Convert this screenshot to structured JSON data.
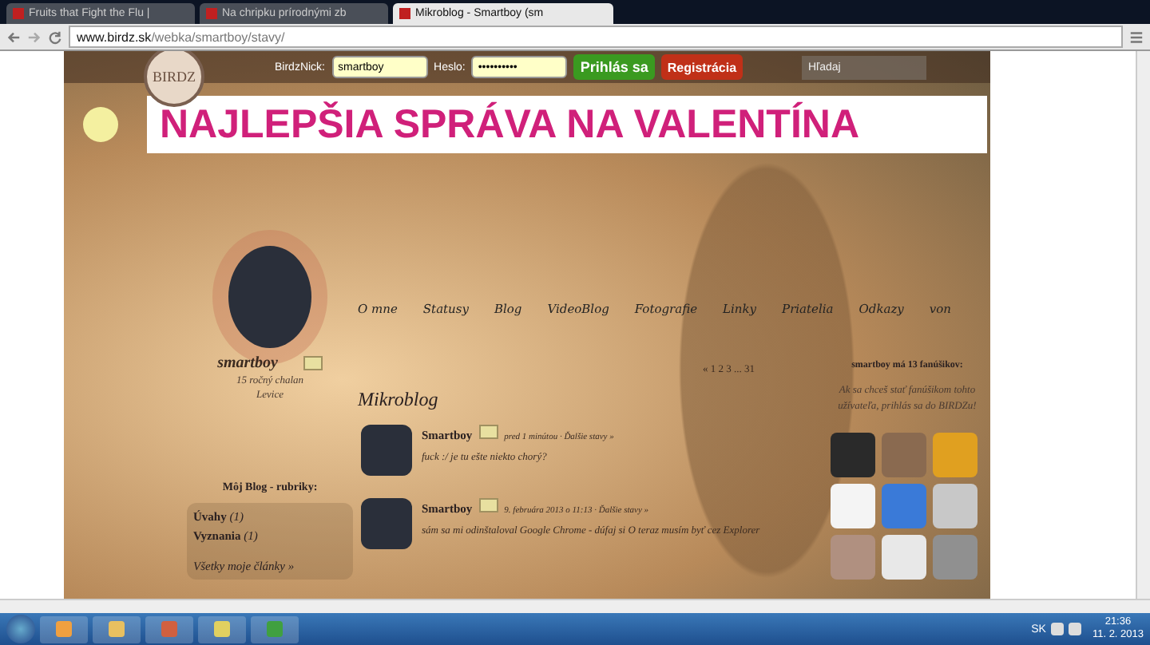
{
  "browser": {
    "tabs": [
      {
        "label": "Fruits that Fight the Flu |",
        "selected": false
      },
      {
        "label": "Na chripku prírodnými zb",
        "selected": false
      },
      {
        "label": "Mikroblog - Smartboy (sm",
        "selected": true
      }
    ],
    "url_host": "www.birdz.sk",
    "url_path": "/webka/smartboy/stavy/"
  },
  "header": {
    "logo": "BIRDZ",
    "nick_label": "BirdzNick:",
    "nick_value": "smartboy",
    "password_label": "Heslo:",
    "password_value": "••••••••••",
    "login_button": "Prihlás sa",
    "register_button": "Registrácia",
    "search": {
      "placeholder": "Hľadaj"
    }
  },
  "banner": "NAJLEPŠIA SPRÁVA NA VALENTÍNA",
  "nav": [
    "O mne",
    "Statusy",
    "Blog",
    "VideoBlog",
    "Fotografie",
    "Linky",
    "Priatelia",
    "Odkazy",
    "von"
  ],
  "profile": {
    "name": "smartboy",
    "age": "15 ročný chalan",
    "city": "Levice"
  },
  "blog": {
    "title": "Môj Blog - rubriky:",
    "categories": [
      {
        "name": "Úvahy",
        "count": "(1)"
      },
      {
        "name": "Vyznania",
        "count": "(1)"
      }
    ],
    "all_link": "Všetky moje články »"
  },
  "mikroblog": {
    "title": "Mikroblog",
    "posts": [
      {
        "author": "Smartboy",
        "meta": "pred 1 minútou · Ďalšie stavy »",
        "text": "fuck :/ je tu ešte niekto chorý?"
      },
      {
        "author": "Smartboy",
        "meta": "9. februára 2013 o 11:13 · Ďalšie stavy »",
        "text": "sám sa mi odinštaloval Google Chrome - dúfaj si O teraz musím byť cez Explorer"
      }
    ],
    "pager": "« 1 2 3 ... 31"
  },
  "fans": {
    "title": "smartboy má 13 fanúšikov:",
    "note": "Ak sa chceš stať fanúšikom tohto užívateľa, prihlás sa do BIRDZu!"
  },
  "taskbar": {
    "language": "SK",
    "time": "21:36",
    "date": "11. 2. 2013"
  }
}
